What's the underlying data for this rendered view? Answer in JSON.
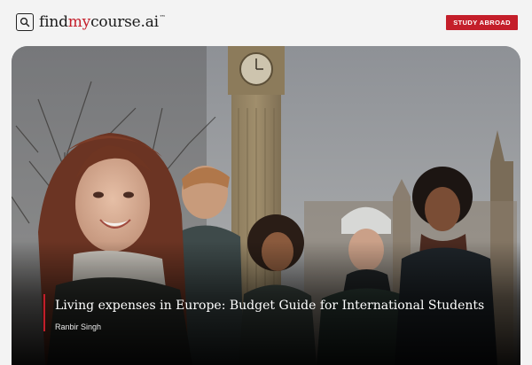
{
  "header": {
    "logo": {
      "part1": "find",
      "part2": "my",
      "part3": "course.ai",
      "tm": "™"
    },
    "cta_label": "STUDY ABROAD"
  },
  "hero": {
    "image_subject": "Group of smiling international students in front of Big Ben, London",
    "headline": "Living expenses in Europe: Budget Guide for International Students",
    "author": "Ranbir Singh"
  },
  "colors": {
    "brand_red": "#c41e2a",
    "header_bg": "#f3f3f3"
  },
  "icons": [
    "search-icon"
  ]
}
